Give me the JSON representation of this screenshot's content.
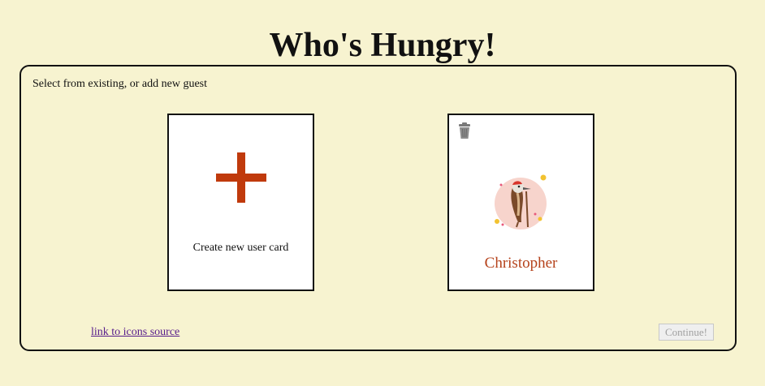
{
  "page": {
    "title": "Who's Hungry!"
  },
  "panel": {
    "instructions": "Select from existing, or add new guest"
  },
  "new_card": {
    "icon": "plus-icon",
    "label": "Create new user card"
  },
  "users": [
    {
      "name": "Christopher",
      "avatar_icon": "woodpecker-icon",
      "delete_icon": "trash-icon"
    }
  ],
  "footer": {
    "link_text": "link to icons source",
    "continue_label": "Continue!",
    "continue_disabled": true
  },
  "colors": {
    "background": "#f7f3d0",
    "accent": "#c03a0c",
    "user_name": "#b5421b"
  }
}
